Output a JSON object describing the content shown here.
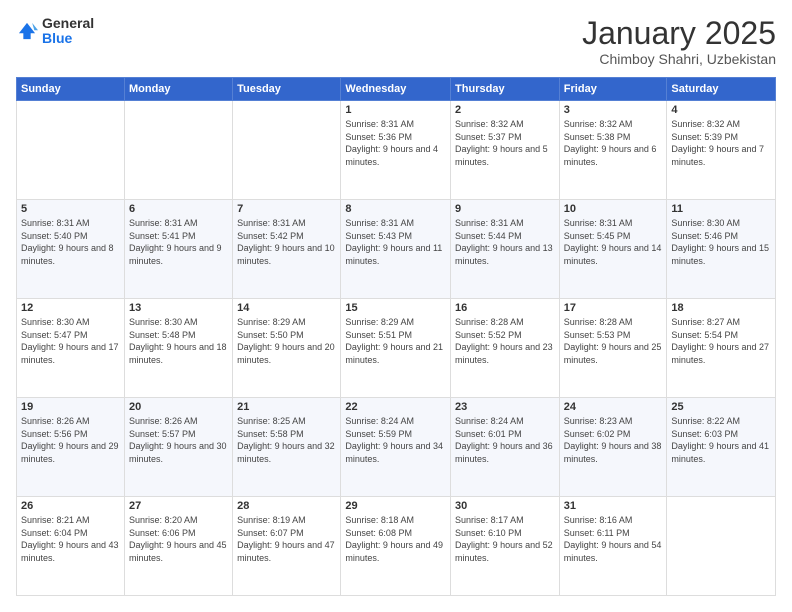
{
  "logo": {
    "general": "General",
    "blue": "Blue"
  },
  "header": {
    "month": "January 2025",
    "location": "Chimboy Shahri, Uzbekistan"
  },
  "weekdays": [
    "Sunday",
    "Monday",
    "Tuesday",
    "Wednesday",
    "Thursday",
    "Friday",
    "Saturday"
  ],
  "weeks": [
    [
      {
        "day": "",
        "sunrise": "",
        "sunset": "",
        "daylight": ""
      },
      {
        "day": "",
        "sunrise": "",
        "sunset": "",
        "daylight": ""
      },
      {
        "day": "",
        "sunrise": "",
        "sunset": "",
        "daylight": ""
      },
      {
        "day": "1",
        "sunrise": "Sunrise: 8:31 AM",
        "sunset": "Sunset: 5:36 PM",
        "daylight": "Daylight: 9 hours and 4 minutes."
      },
      {
        "day": "2",
        "sunrise": "Sunrise: 8:32 AM",
        "sunset": "Sunset: 5:37 PM",
        "daylight": "Daylight: 9 hours and 5 minutes."
      },
      {
        "day": "3",
        "sunrise": "Sunrise: 8:32 AM",
        "sunset": "Sunset: 5:38 PM",
        "daylight": "Daylight: 9 hours and 6 minutes."
      },
      {
        "day": "4",
        "sunrise": "Sunrise: 8:32 AM",
        "sunset": "Sunset: 5:39 PM",
        "daylight": "Daylight: 9 hours and 7 minutes."
      }
    ],
    [
      {
        "day": "5",
        "sunrise": "Sunrise: 8:31 AM",
        "sunset": "Sunset: 5:40 PM",
        "daylight": "Daylight: 9 hours and 8 minutes."
      },
      {
        "day": "6",
        "sunrise": "Sunrise: 8:31 AM",
        "sunset": "Sunset: 5:41 PM",
        "daylight": "Daylight: 9 hours and 9 minutes."
      },
      {
        "day": "7",
        "sunrise": "Sunrise: 8:31 AM",
        "sunset": "Sunset: 5:42 PM",
        "daylight": "Daylight: 9 hours and 10 minutes."
      },
      {
        "day": "8",
        "sunrise": "Sunrise: 8:31 AM",
        "sunset": "Sunset: 5:43 PM",
        "daylight": "Daylight: 9 hours and 11 minutes."
      },
      {
        "day": "9",
        "sunrise": "Sunrise: 8:31 AM",
        "sunset": "Sunset: 5:44 PM",
        "daylight": "Daylight: 9 hours and 13 minutes."
      },
      {
        "day": "10",
        "sunrise": "Sunrise: 8:31 AM",
        "sunset": "Sunset: 5:45 PM",
        "daylight": "Daylight: 9 hours and 14 minutes."
      },
      {
        "day": "11",
        "sunrise": "Sunrise: 8:30 AM",
        "sunset": "Sunset: 5:46 PM",
        "daylight": "Daylight: 9 hours and 15 minutes."
      }
    ],
    [
      {
        "day": "12",
        "sunrise": "Sunrise: 8:30 AM",
        "sunset": "Sunset: 5:47 PM",
        "daylight": "Daylight: 9 hours and 17 minutes."
      },
      {
        "day": "13",
        "sunrise": "Sunrise: 8:30 AM",
        "sunset": "Sunset: 5:48 PM",
        "daylight": "Daylight: 9 hours and 18 minutes."
      },
      {
        "day": "14",
        "sunrise": "Sunrise: 8:29 AM",
        "sunset": "Sunset: 5:50 PM",
        "daylight": "Daylight: 9 hours and 20 minutes."
      },
      {
        "day": "15",
        "sunrise": "Sunrise: 8:29 AM",
        "sunset": "Sunset: 5:51 PM",
        "daylight": "Daylight: 9 hours and 21 minutes."
      },
      {
        "day": "16",
        "sunrise": "Sunrise: 8:28 AM",
        "sunset": "Sunset: 5:52 PM",
        "daylight": "Daylight: 9 hours and 23 minutes."
      },
      {
        "day": "17",
        "sunrise": "Sunrise: 8:28 AM",
        "sunset": "Sunset: 5:53 PM",
        "daylight": "Daylight: 9 hours and 25 minutes."
      },
      {
        "day": "18",
        "sunrise": "Sunrise: 8:27 AM",
        "sunset": "Sunset: 5:54 PM",
        "daylight": "Daylight: 9 hours and 27 minutes."
      }
    ],
    [
      {
        "day": "19",
        "sunrise": "Sunrise: 8:26 AM",
        "sunset": "Sunset: 5:56 PM",
        "daylight": "Daylight: 9 hours and 29 minutes."
      },
      {
        "day": "20",
        "sunrise": "Sunrise: 8:26 AM",
        "sunset": "Sunset: 5:57 PM",
        "daylight": "Daylight: 9 hours and 30 minutes."
      },
      {
        "day": "21",
        "sunrise": "Sunrise: 8:25 AM",
        "sunset": "Sunset: 5:58 PM",
        "daylight": "Daylight: 9 hours and 32 minutes."
      },
      {
        "day": "22",
        "sunrise": "Sunrise: 8:24 AM",
        "sunset": "Sunset: 5:59 PM",
        "daylight": "Daylight: 9 hours and 34 minutes."
      },
      {
        "day": "23",
        "sunrise": "Sunrise: 8:24 AM",
        "sunset": "Sunset: 6:01 PM",
        "daylight": "Daylight: 9 hours and 36 minutes."
      },
      {
        "day": "24",
        "sunrise": "Sunrise: 8:23 AM",
        "sunset": "Sunset: 6:02 PM",
        "daylight": "Daylight: 9 hours and 38 minutes."
      },
      {
        "day": "25",
        "sunrise": "Sunrise: 8:22 AM",
        "sunset": "Sunset: 6:03 PM",
        "daylight": "Daylight: 9 hours and 41 minutes."
      }
    ],
    [
      {
        "day": "26",
        "sunrise": "Sunrise: 8:21 AM",
        "sunset": "Sunset: 6:04 PM",
        "daylight": "Daylight: 9 hours and 43 minutes."
      },
      {
        "day": "27",
        "sunrise": "Sunrise: 8:20 AM",
        "sunset": "Sunset: 6:06 PM",
        "daylight": "Daylight: 9 hours and 45 minutes."
      },
      {
        "day": "28",
        "sunrise": "Sunrise: 8:19 AM",
        "sunset": "Sunset: 6:07 PM",
        "daylight": "Daylight: 9 hours and 47 minutes."
      },
      {
        "day": "29",
        "sunrise": "Sunrise: 8:18 AM",
        "sunset": "Sunset: 6:08 PM",
        "daylight": "Daylight: 9 hours and 49 minutes."
      },
      {
        "day": "30",
        "sunrise": "Sunrise: 8:17 AM",
        "sunset": "Sunset: 6:10 PM",
        "daylight": "Daylight: 9 hours and 52 minutes."
      },
      {
        "day": "31",
        "sunrise": "Sunrise: 8:16 AM",
        "sunset": "Sunset: 6:11 PM",
        "daylight": "Daylight: 9 hours and 54 minutes."
      },
      {
        "day": "",
        "sunrise": "",
        "sunset": "",
        "daylight": ""
      }
    ]
  ]
}
